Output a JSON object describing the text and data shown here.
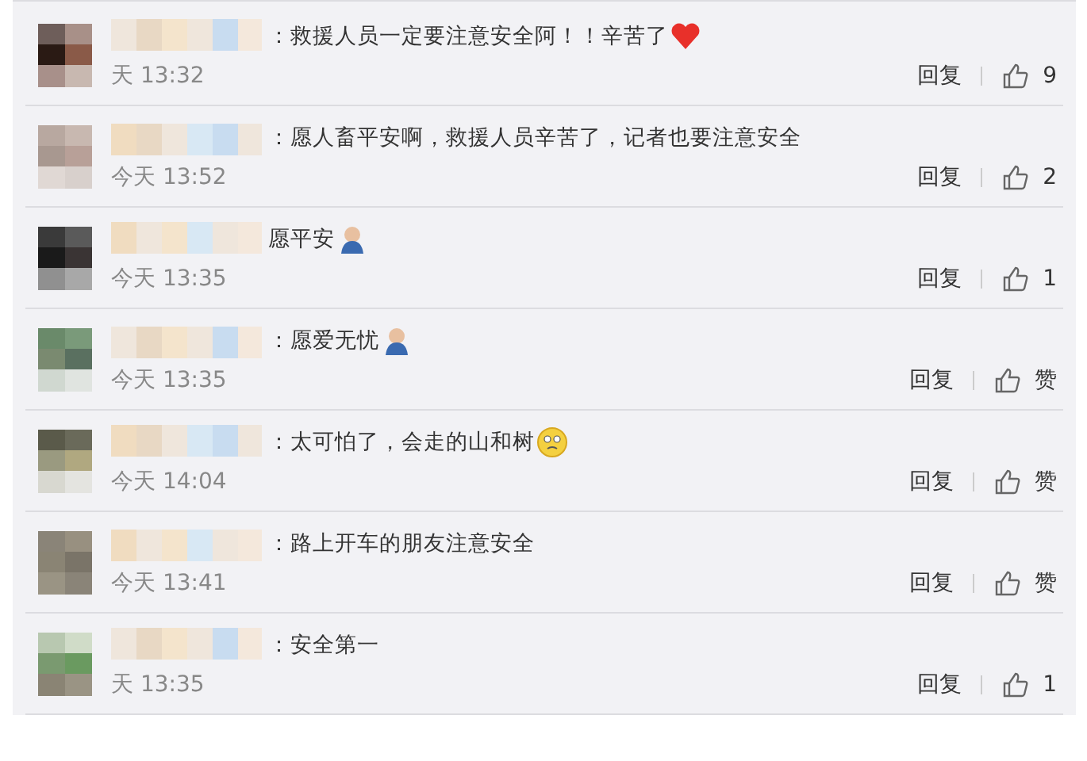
{
  "comments": [
    {
      "text": "：救援人员一定要注意安全阿！！辛苦了",
      "emoji": {
        "kind": "heart"
      },
      "time": "天 13:32",
      "reply": "回复",
      "likes": "9"
    },
    {
      "text": "：愿人畜平安啊，救援人员辛苦了，记者也要注意安全",
      "time": "今天 13:52",
      "reply": "回复",
      "likes": "2"
    },
    {
      "text": "愿平安",
      "emoji": {
        "kind": "pray"
      },
      "time": "今天 13:35",
      "reply": "回复",
      "likes": "1"
    },
    {
      "text": "：愿爱无忧",
      "emoji": {
        "kind": "pray"
      },
      "time": "今天 13:35",
      "reply": "回复",
      "likes": "赞"
    },
    {
      "text": "：太可怕了，会走的山和树",
      "emoji": {
        "kind": "worried"
      },
      "time": "今天 14:04",
      "reply": "回复",
      "likes": "赞"
    },
    {
      "text": "：路上开车的朋友注意安全",
      "time": "今天 13:41",
      "reply": "回复",
      "likes": "赞"
    },
    {
      "text": "：安全第一",
      "time": "天 13:35",
      "reply": "回复",
      "likes": "1"
    }
  ]
}
